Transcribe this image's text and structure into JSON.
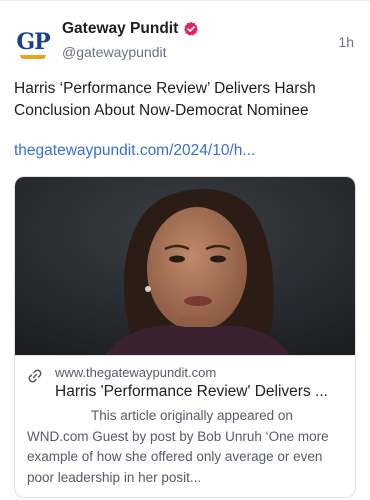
{
  "post": {
    "author_name": "Gateway Pundit",
    "author_handle": "@gatewaypundit",
    "avatar_text": "GP",
    "time": "1h",
    "text": "Harris ‘Performance Review’ Delivers Harsh Conclusion About Now-Democrat Nominee",
    "link_text": "thegatewaypundit.com/2024/10/h...",
    "icons": [
      "verified-badge-icon",
      "link-icon"
    ],
    "colors": {
      "link": "#3b6fc9",
      "verified": "#e0245e",
      "brand_blue": "#1d3f8f",
      "brand_gold": "#e8a21b"
    }
  },
  "card": {
    "domain": "www.thegatewaypundit.com",
    "title": "Harris 'Performance Review' Delivers ...",
    "description": "This article originally appeared on WND.com Guest by post by Bob Unruh ‘One more example of how she offered only average or even poor leadership in her posit..."
  }
}
